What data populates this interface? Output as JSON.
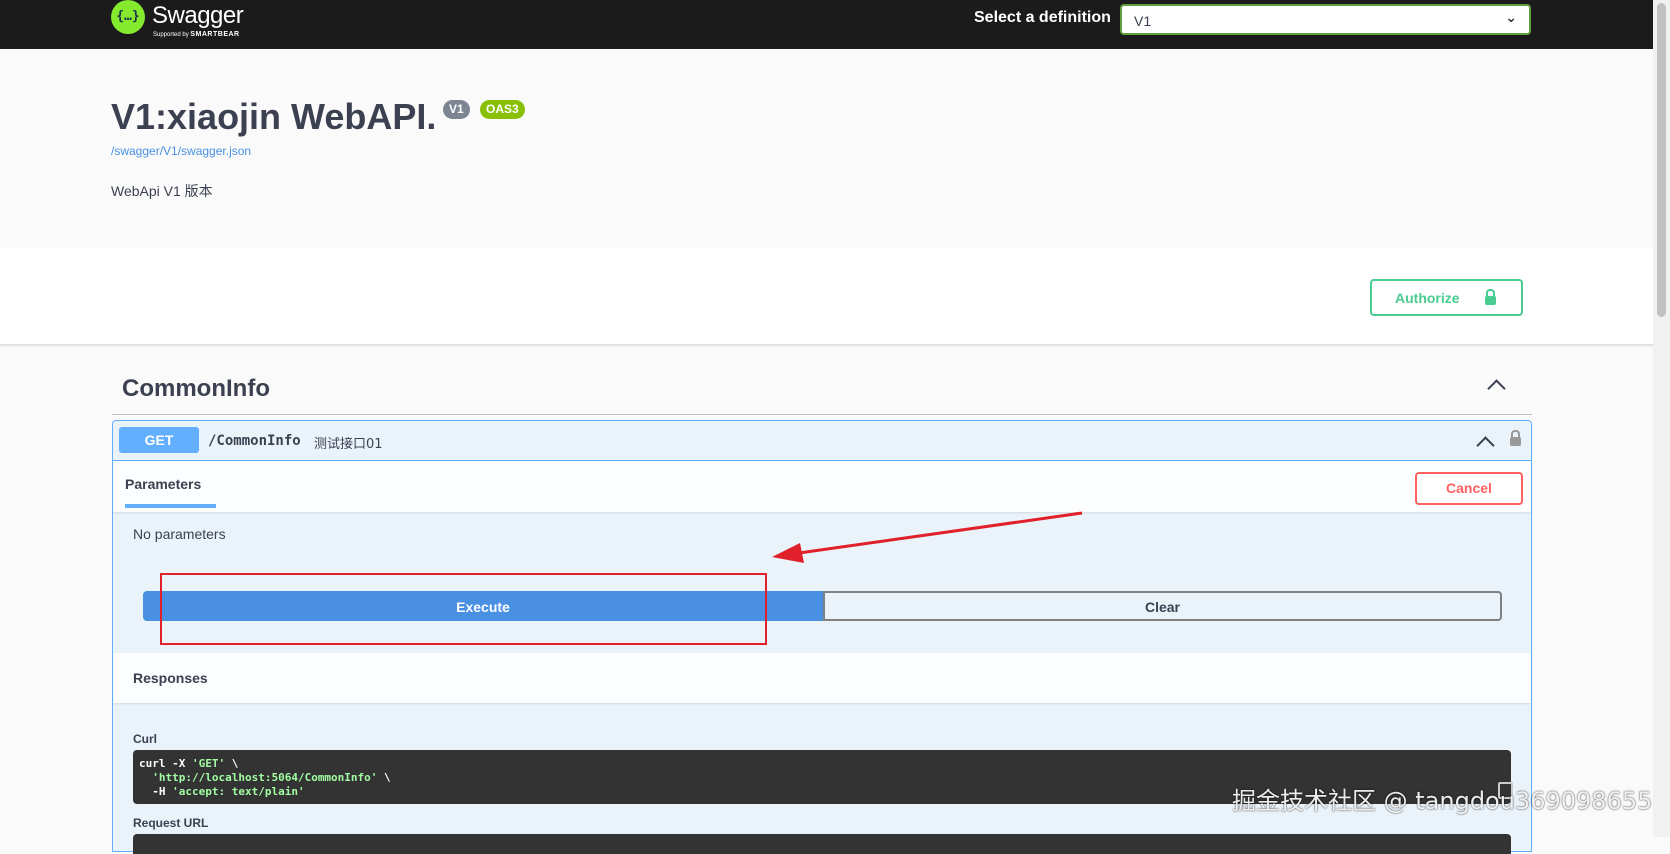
{
  "topbar": {
    "brand": "Swagger",
    "brand_sub_prefix": "Supported by",
    "brand_sub_name": "SMARTBEAR",
    "logo_glyph": "{…}",
    "definition_label": "Select a definition",
    "definition_value": "V1"
  },
  "info": {
    "title": "V1:xiaojin WebAPI.",
    "version_badge": "V1",
    "oas_badge": "OAS3",
    "spec_link": "/swagger/V1/swagger.json",
    "description": "WebApi V1 版本"
  },
  "authorize": {
    "label": "Authorize"
  },
  "tag": {
    "name": "CommonInfo"
  },
  "operation": {
    "method": "GET",
    "path": "/CommonInfo",
    "summary": "测试接口01",
    "parameters_tab": "Parameters",
    "cancel_label": "Cancel",
    "no_parameters": "No parameters",
    "execute_label": "Execute",
    "clear_label": "Clear",
    "responses_title": "Responses",
    "curl_label": "Curl",
    "curl_lines": [
      {
        "code": "curl -X ",
        "str": "'GET'",
        "tail": " \\"
      },
      {
        "code": "  ",
        "str": "'http://localhost:5064/CommonInfo'",
        "tail": " \\"
      },
      {
        "code": "  -H ",
        "str": "'accept: text/plain'",
        "tail": ""
      }
    ],
    "request_url_label": "Request URL"
  },
  "watermark": "掘金技术社区 @ tangdou369098655",
  "colors": {
    "get": "#61affe",
    "authorize": "#49cc90",
    "cancel": "#ff6060",
    "execute": "#4990e2",
    "annotation": "#e0202a"
  }
}
